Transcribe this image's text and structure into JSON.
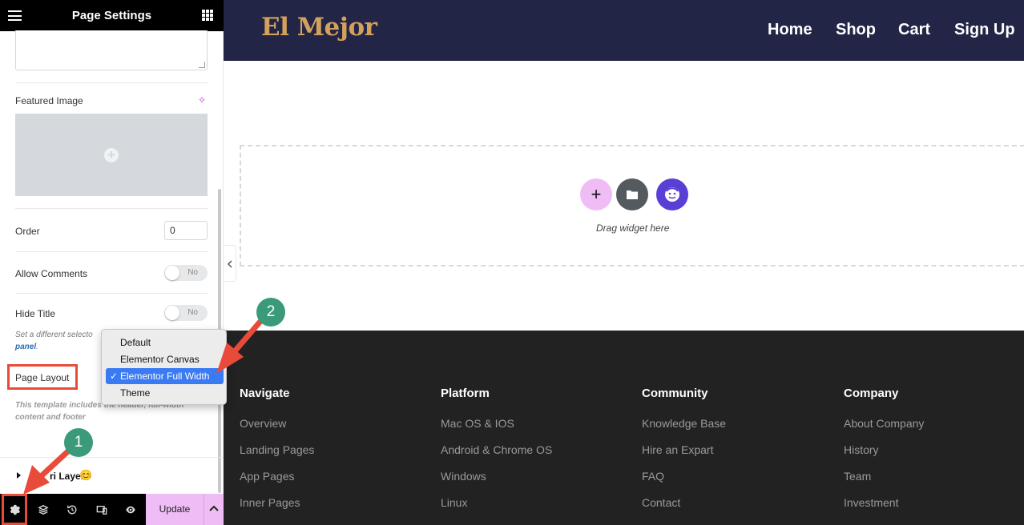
{
  "panel": {
    "title": "Page Settings",
    "featured_image_label": "Featured Image",
    "order_label": "Order",
    "order_value": "0",
    "allow_comments_label": "Allow Comments",
    "allow_comments_state": "No",
    "hide_title_label": "Hide Title",
    "hide_title_state": "No",
    "hide_title_note_prefix": "Set a different selecto",
    "hide_title_note_link": "panel",
    "page_layout_label": "Page Layout",
    "page_layout_note_line1": "This template includes the header, full-width",
    "page_layout_note_line2": "content and footer",
    "layer_label": "ri Layer",
    "layer_emoji": "😊"
  },
  "dropdown": {
    "options": [
      "Default",
      "Elementor Canvas",
      "Elementor Full Width",
      "Theme"
    ],
    "selected": "Elementor Full Width",
    "check": "✓"
  },
  "bottom_bar": {
    "update_label": "Update"
  },
  "site": {
    "logo": "El Mejor",
    "nav": [
      "Home",
      "Shop",
      "Cart",
      "Sign Up"
    ],
    "drag_text": "Drag widget here",
    "footer": [
      {
        "title": "Navigate",
        "links": [
          "Overview",
          "Landing Pages",
          "App Pages",
          "Inner Pages"
        ]
      },
      {
        "title": "Platform",
        "links": [
          "Mac OS & IOS",
          "Android & Chrome OS",
          "Windows",
          "Linux"
        ]
      },
      {
        "title": "Community",
        "links": [
          "Knowledge Base",
          "Hire an Expart",
          "FAQ",
          "Contact"
        ]
      },
      {
        "title": "Company",
        "links": [
          "About Company",
          "History",
          "Team",
          "Investment"
        ]
      }
    ]
  },
  "annotations": {
    "step1": "1",
    "step2": "2"
  },
  "colors": {
    "header_bg": "#222546",
    "logo": "#d4a15d",
    "footer_bg": "#222222",
    "accent_pink": "#f0bcf5",
    "arrow_red": "#e84b3a",
    "badge_green": "#3a9a7a",
    "select_blue": "#3a7af2"
  }
}
